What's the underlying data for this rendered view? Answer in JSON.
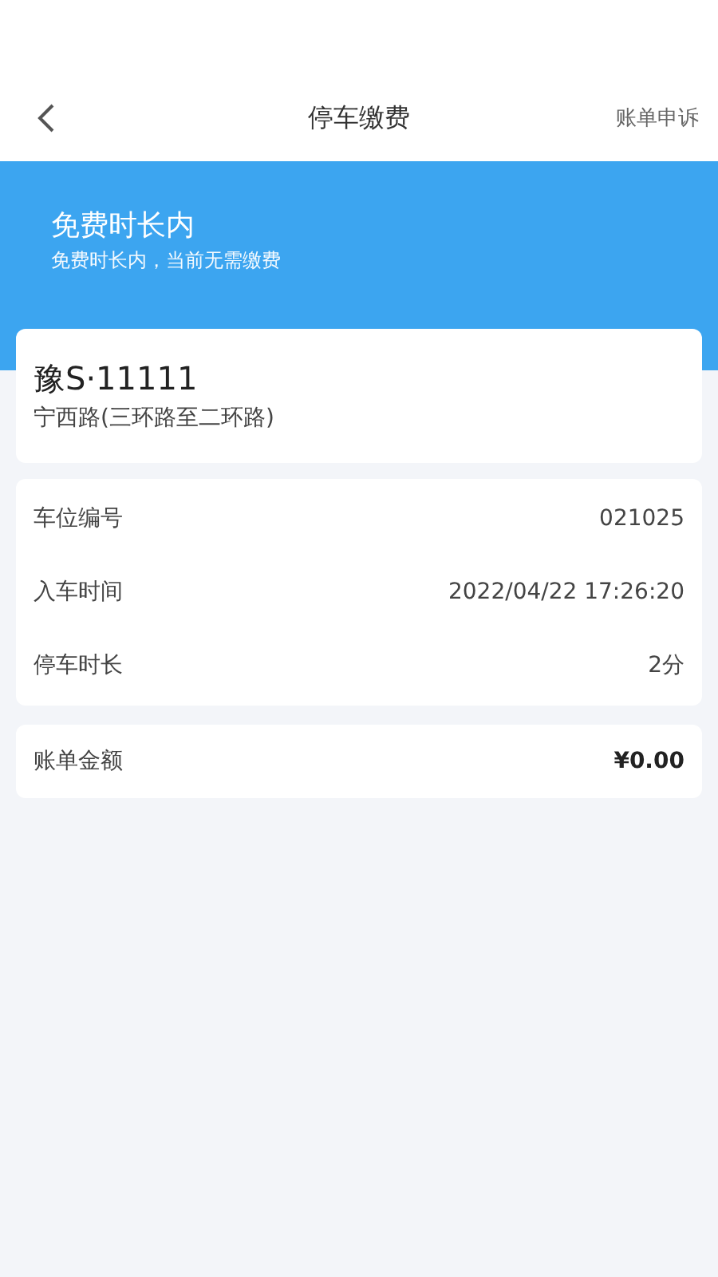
{
  "nav": {
    "title": "停车缴费",
    "action": "账单申诉"
  },
  "banner": {
    "title": "免费时长内",
    "subtitle": "免费时长内，当前无需缴费"
  },
  "vehicle": {
    "plate": "豫S·11111",
    "location": "宁西路(三环路至二环路)"
  },
  "details": [
    {
      "label": "车位编号",
      "value": "021025"
    },
    {
      "label": "入车时间",
      "value": "2022/04/22 17:26:20"
    },
    {
      "label": "停车时长",
      "value": "2分"
    }
  ],
  "bill": {
    "label": "账单金额",
    "value": "¥0.00"
  }
}
